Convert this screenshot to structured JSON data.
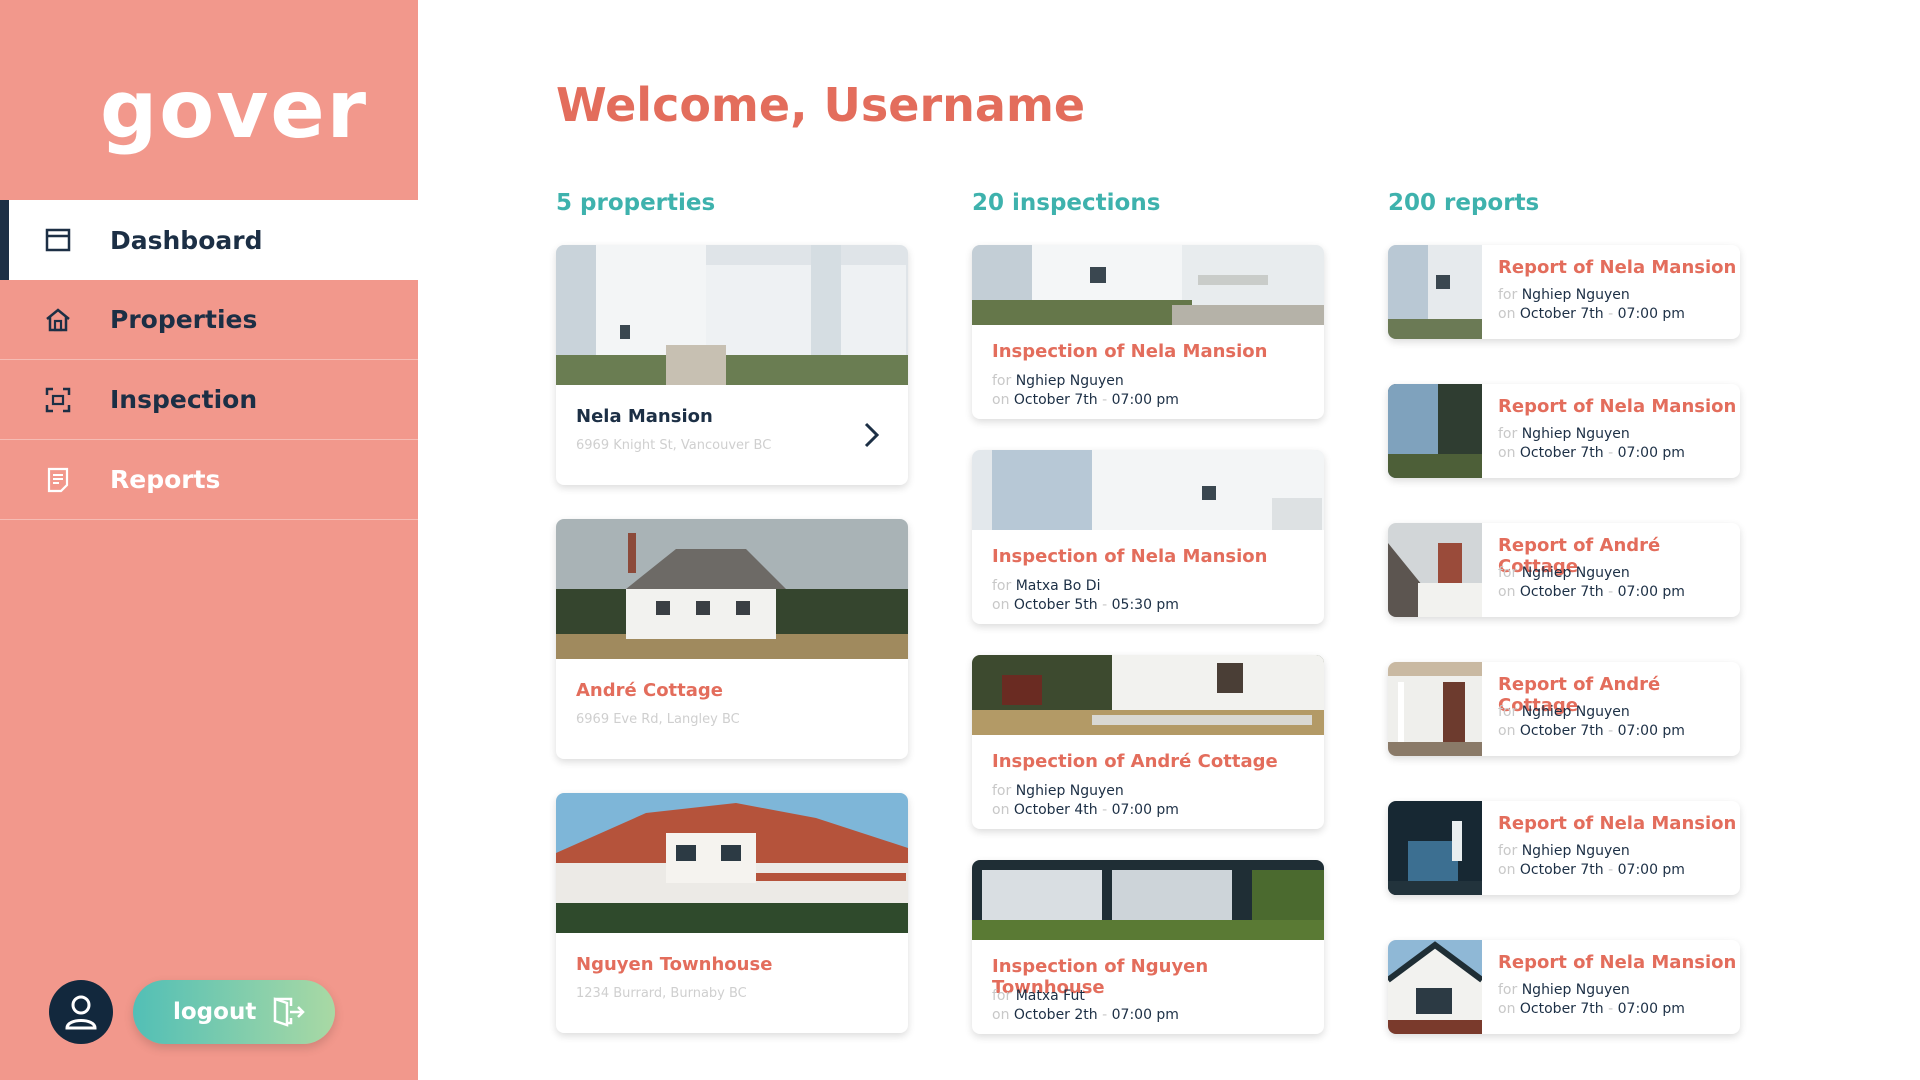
{
  "app": {
    "logo": "gover",
    "welcome": "Welcome, Username"
  },
  "colors": {
    "sidebar": "#f2988c",
    "navy": "#1c2f45",
    "coral": "#e36d5c",
    "teal": "#3eb2ad"
  },
  "sidebar": {
    "items": [
      {
        "label": "Dashboard",
        "icon": "window-icon",
        "active": true
      },
      {
        "label": "Properties",
        "icon": "house-icon"
      },
      {
        "label": "Inspection",
        "icon": "scan-icon"
      },
      {
        "label": "Reports",
        "icon": "document-icon"
      }
    ],
    "logout_label": "logout"
  },
  "columns": {
    "properties_heading": "5 properties",
    "inspections_heading": "20 inspections",
    "reports_heading": "200 reports"
  },
  "properties": [
    {
      "name": "Nela Mansion",
      "address": "6969 Knight St, Vancouver BC"
    },
    {
      "name": "André Cottage",
      "address": "6969 Eve Rd, Langley BC"
    },
    {
      "name": "Nguyen Townhouse",
      "address": "1234 Burrard, Burnaby BC"
    }
  ],
  "inspections": [
    {
      "title": "Inspection of Nela Mansion",
      "for_prefix": "for",
      "person": "Nghiep Nguyen",
      "on_prefix": "on",
      "date": "October 7th",
      "time": "07:00 pm"
    },
    {
      "title": "Inspection of Nela Mansion",
      "for_prefix": "for",
      "person": "Matxa Bo Di",
      "on_prefix": "on",
      "date": "October 5th",
      "time": "05:30 pm"
    },
    {
      "title": "Inspection of André Cottage",
      "for_prefix": "for",
      "person": "Nghiep Nguyen",
      "on_prefix": "on",
      "date": "October 4th",
      "time": "07:00 pm"
    },
    {
      "title": "Inspection of Nguyen Townhouse",
      "for_prefix": "for",
      "person": "Matxa Fut",
      "on_prefix": "on",
      "date": "October 2th",
      "time": "07:00 pm"
    }
  ],
  "reports": [
    {
      "title": "Report of Nela Mansion",
      "for_prefix": "for",
      "person": "Nghiep Nguyen",
      "on_prefix": "on",
      "date": "October 7th",
      "time": "07:00 pm"
    },
    {
      "title": "Report of Nela Mansion",
      "for_prefix": "for",
      "person": "Nghiep Nguyen",
      "on_prefix": "on",
      "date": "October 7th",
      "time": "07:00 pm"
    },
    {
      "title": "Report of André Cottage",
      "for_prefix": "for",
      "person": "Nghiep Nguyen",
      "on_prefix": "on",
      "date": "October 7th",
      "time": "07:00 pm"
    },
    {
      "title": "Report of André Cottage",
      "for_prefix": "for",
      "person": "Nghiep Nguyen",
      "on_prefix": "on",
      "date": "October 7th",
      "time": "07:00 pm"
    },
    {
      "title": "Report of Nela Mansion",
      "for_prefix": "for",
      "person": "Nghiep Nguyen",
      "on_prefix": "on",
      "date": "October 7th",
      "time": "07:00 pm"
    },
    {
      "title": "Report of Nela Mansion",
      "for_prefix": "for",
      "person": "Nghiep Nguyen",
      "on_prefix": "on",
      "date": "October 7th",
      "time": "07:00 pm"
    }
  ],
  "separator": "-"
}
